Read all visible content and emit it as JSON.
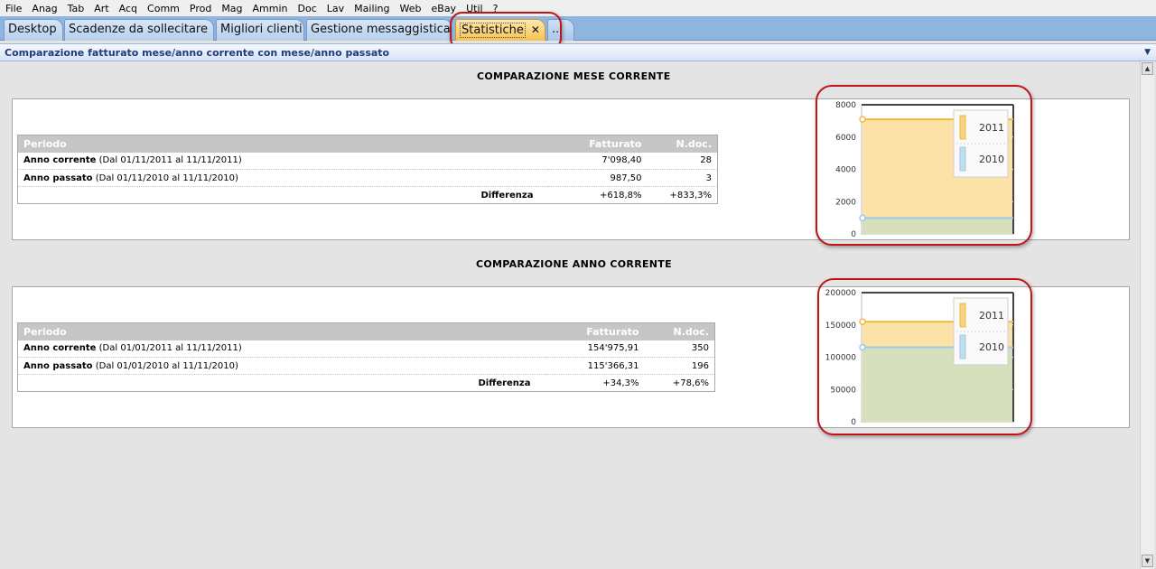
{
  "menu": [
    "File",
    "Anag",
    "Tab",
    "Art",
    "Acq",
    "Comm",
    "Prod",
    "Mag",
    "Ammin",
    "Doc",
    "Lav",
    "Mailing",
    "Web",
    "eBay",
    "Util",
    "?"
  ],
  "tabs": [
    {
      "label": "Desktop"
    },
    {
      "label": "Scadenze da sollecitare"
    },
    {
      "label": "Migliori clienti"
    },
    {
      "label": "Gestione messaggistica"
    },
    {
      "label": "Statistiche",
      "close": "✕"
    },
    {
      "label": "..."
    }
  ],
  "section_title": "Comparazione fatturato mese/anno corrente con mese/anno passato",
  "month": {
    "title": "COMPARAZIONE MESE CORRENTE",
    "table": {
      "headers": [
        "Periodo",
        "Fatturato",
        "N.doc."
      ],
      "rows": [
        {
          "label_bold": "Anno corrente",
          "label_range": "(Dal 01/11/2011 al 11/11/2011)",
          "fatturato": "7'098,40",
          "ndoc": "28"
        },
        {
          "label_bold": "Anno passato",
          "label_range": "(Dal 01/11/2010 al 11/11/2010)",
          "fatturato": "987,50",
          "ndoc": "3"
        }
      ],
      "diff": {
        "label": "Differenza",
        "fatturato": "+618,8%",
        "ndoc": "+833,3%"
      }
    }
  },
  "year": {
    "title": "COMPARAZIONE ANNO CORRENTE",
    "table": {
      "headers": [
        "Periodo",
        "Fatturato",
        "N.doc."
      ],
      "rows": [
        {
          "label_bold": "Anno corrente",
          "label_range": "(Dal 01/01/2011 al 11/11/2011)",
          "fatturato": "154'975,91",
          "ndoc": "350"
        },
        {
          "label_bold": "Anno passato",
          "label_range": "(Dal 01/01/2010 al 11/11/2010)",
          "fatturato": "115'366,31",
          "ndoc": "196"
        }
      ],
      "diff": {
        "label": "Differenza",
        "fatturato": "+34,3%",
        "ndoc": "+78,6%"
      }
    }
  },
  "colors": {
    "series_2011": "#f0b93a",
    "series_2010": "#9cc8ea",
    "highlight": "#c0141b"
  },
  "chart_data": [
    {
      "type": "area",
      "ylim": [
        0,
        8000
      ],
      "yticks": [
        "0",
        "2000",
        "4000",
        "6000",
        "8000"
      ],
      "legend_position": "top-right",
      "series": [
        {
          "name": "2011",
          "values": [
            7098.4,
            7098.4
          ]
        },
        {
          "name": "2010",
          "values": [
            987.5,
            987.5
          ]
        }
      ]
    },
    {
      "type": "area",
      "ylim": [
        0,
        200000
      ],
      "yticks": [
        "0",
        "50000",
        "100000",
        "150000",
        "200000"
      ],
      "legend_position": "top-right",
      "series": [
        {
          "name": "2011",
          "values": [
            154975.91,
            154975.91
          ]
        },
        {
          "name": "2010",
          "values": [
            115366.31,
            115366.31
          ]
        }
      ]
    }
  ]
}
